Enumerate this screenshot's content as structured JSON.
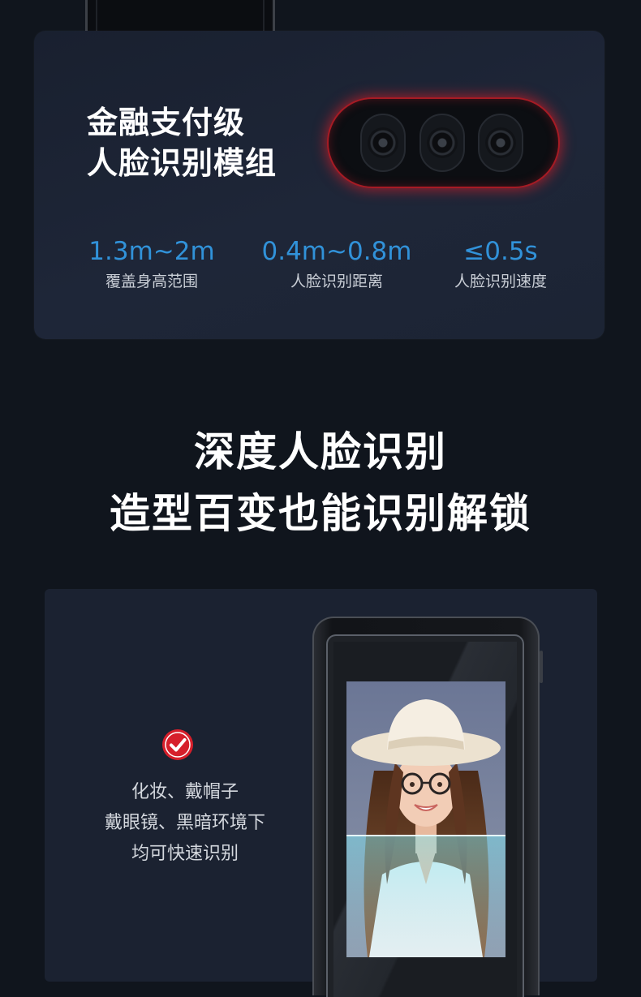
{
  "module": {
    "title_lines": [
      "金融支付级",
      "人脸识别模组"
    ],
    "stats": [
      {
        "value": "1.3m~2m",
        "label": "覆盖身高范围"
      },
      {
        "value": "0.4m~0.8m",
        "label": "人脸识别距离"
      },
      {
        "value": "≤0.5s",
        "label": "人脸识别速度"
      }
    ]
  },
  "headline": {
    "line1": "深度人脸识别",
    "line2": "造型百变也能识别解锁"
  },
  "feature": {
    "icon": "check-circle-icon",
    "lines": [
      "化妆、戴帽子",
      "戴眼镜、黑暗环境下",
      "均可快速识别"
    ]
  },
  "colors": {
    "background": "#10151d",
    "card": "#1c2434",
    "accent_blue": "#3192d9",
    "check_red": "#d61f2b",
    "camera_glow_red": "#a61b24"
  }
}
